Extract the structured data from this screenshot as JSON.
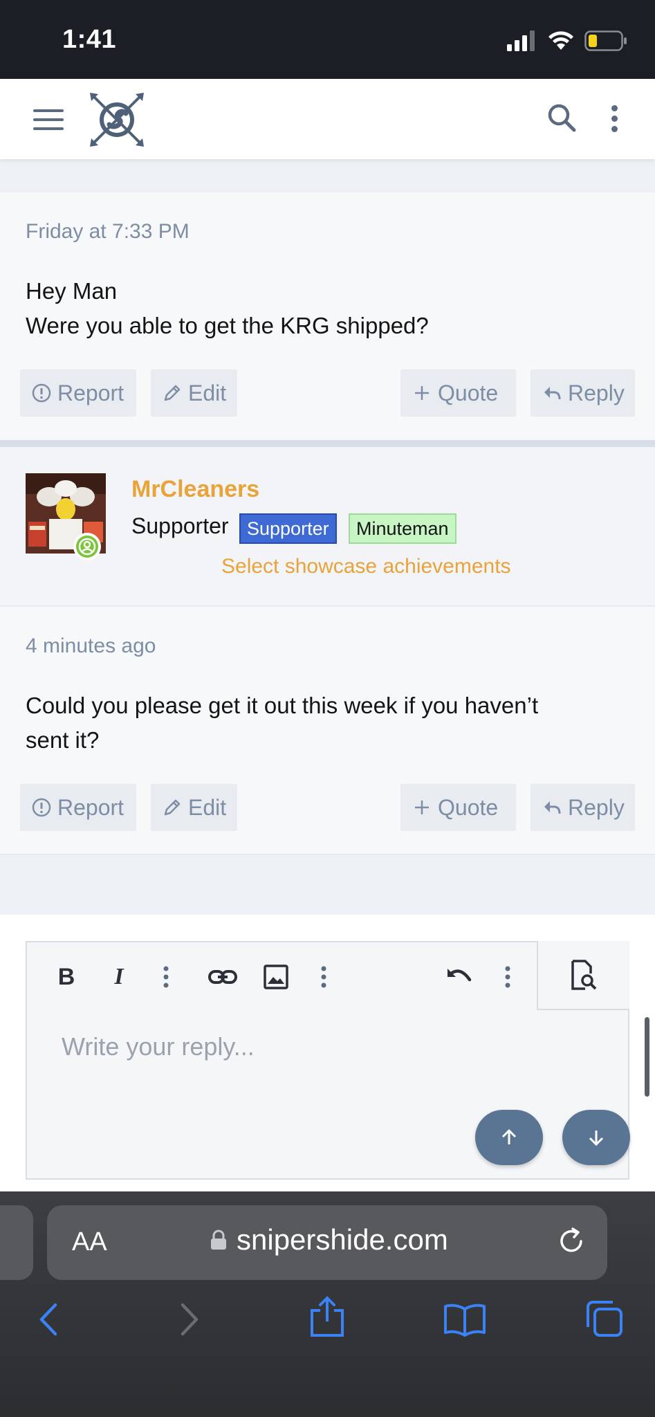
{
  "status_bar": {
    "time": "1:41"
  },
  "posts": [
    {
      "time": "Friday at 7:33 PM",
      "body_lines": [
        "Hey Man",
        "Were you able to get the KRG shipped?"
      ],
      "actions": {
        "report": "Report",
        "edit": "Edit",
        "quote": "Quote",
        "reply": "Reply"
      }
    },
    {
      "time": "4 minutes ago",
      "body_lines": [
        "Could you please get it out this week if you haven’t",
        "sent it?"
      ],
      "actions": {
        "report": "Report",
        "edit": "Edit",
        "quote": "Quote",
        "reply": "Reply"
      }
    }
  ],
  "user": {
    "name": "MrCleaners",
    "title": "Supporter",
    "badges": [
      "Supporter",
      "Minuteman"
    ],
    "showcase_link": "Select showcase achievements",
    "online": true
  },
  "editor": {
    "placeholder": "Write your reply..."
  },
  "browser": {
    "text_size_label": "AA",
    "url": "snipershide.com"
  },
  "colors": {
    "accent": "#e8a33a",
    "muted": "#7d8ea4",
    "supporter_badge": "#3e6ad6",
    "minuteman_badge": "#c8f5c4",
    "ios_blue": "#3b82f6"
  }
}
